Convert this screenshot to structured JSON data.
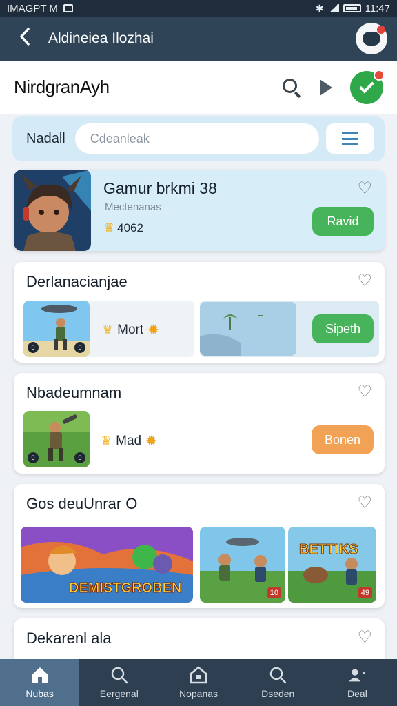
{
  "status_bar": {
    "left_text": "IMAGPT M",
    "time": "11:47"
  },
  "app_bar": {
    "title": "Aldineiea Ilozhai",
    "back_icon": "chevron-left-icon",
    "avatar_icon": "avatar-icon"
  },
  "header": {
    "brand": "NirdgranAyh",
    "search_icon": "search-icon",
    "play_icon": "play-icon",
    "status_icon": "check-circle-icon"
  },
  "search": {
    "label": "Nadall",
    "placeholder": "Cdeanleak",
    "filter_icon": "filter-icon"
  },
  "featured": {
    "title": "Gamur brkmi 38",
    "subtitle": "Mectenanas",
    "rating": "4062",
    "button": "Ravid",
    "accent": "#47b35a"
  },
  "cards": [
    {
      "title": "Derlanacianjae",
      "info": "Mort",
      "button": "Sipeth",
      "badge": "0"
    },
    {
      "title": "Nbadeumnam",
      "info": "Mad",
      "button": "Bonen",
      "badge": "0"
    },
    {
      "title": "Gos deuUnrar O",
      "tiles": [
        {
          "caption": "DEMISTGROBEN"
        },
        {
          "badge": "10"
        },
        {
          "caption": "BETTIKS",
          "badge": "49"
        }
      ]
    },
    {
      "title": "Dekarenl ala"
    }
  ],
  "bottom_nav": [
    {
      "label": "Nubas",
      "icon": "home-icon"
    },
    {
      "label": "Eergenal",
      "icon": "search-icon"
    },
    {
      "label": "Nopanas",
      "icon": "store-icon"
    },
    {
      "label": "Dseden",
      "icon": "search-icon"
    },
    {
      "label": "Deal",
      "icon": "profile-icon"
    }
  ],
  "colors": {
    "app_bar": "#2f4457",
    "bottom_nav": "#2d3f51",
    "green": "#47b35a",
    "orange": "#f2a255"
  }
}
